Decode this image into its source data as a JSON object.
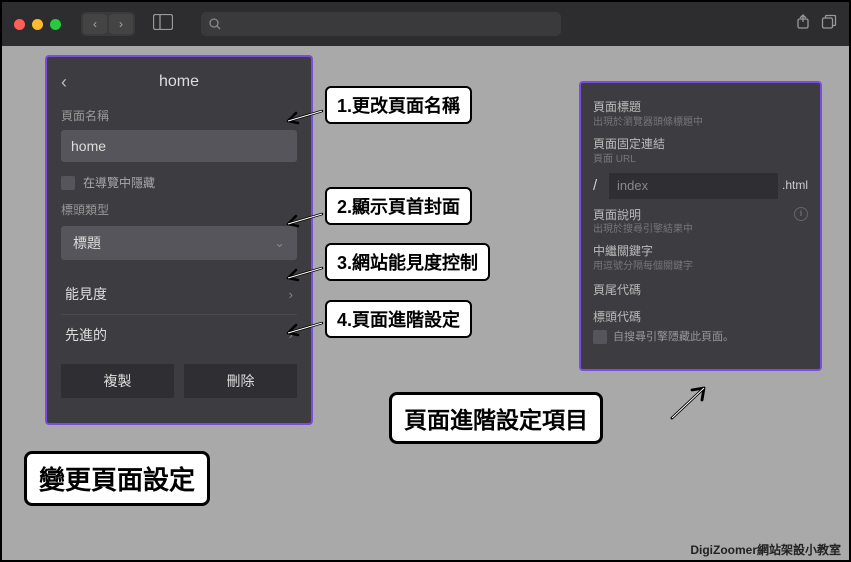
{
  "titlebar": {
    "search_placeholder": ""
  },
  "left_panel": {
    "title": "home",
    "page_name_label": "頁面名稱",
    "page_name_value": "home",
    "hide_in_nav": "在導覽中隱藏",
    "header_type_label": "標頭類型",
    "header_type_value": "標題",
    "visibility": "能見度",
    "advanced": "先進的",
    "duplicate": "複製",
    "delete": "刪除"
  },
  "right_panel": {
    "title_label": "頁面標題",
    "title_hint": "出現於瀏覽器頭條標題中",
    "permalink_label": "頁面固定連結",
    "permalink_hint": "頁面 URL",
    "url_slash": "/",
    "url_value": "index",
    "url_ext": ".html",
    "desc_label": "頁面說明",
    "desc_hint": "出現於搜尋引擎結果中",
    "keywords_label": "中繼關鍵字",
    "keywords_hint": "用逗號分隔每個關鍵字",
    "footer_code": "頁尾代碼",
    "header_code": "標頭代碼",
    "hide_search": "自搜尋引擎隱藏此頁面。"
  },
  "callouts": {
    "c1": "1.更改頁面名稱",
    "c2": "2.顯示頁首封面",
    "c3": "3.網站能見度控制",
    "c4": "4.頁面進階設定",
    "right_big": "頁面進階設定項目",
    "left_big": "變更頁面設定"
  },
  "footer": "DigiZoomer網站架設小教室"
}
